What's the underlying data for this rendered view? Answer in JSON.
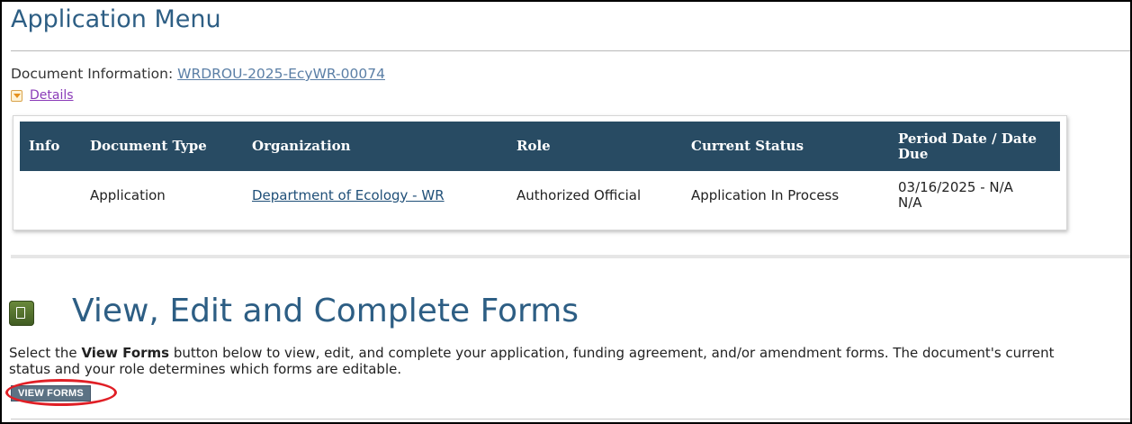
{
  "header": {
    "title": "Application Menu"
  },
  "document_info": {
    "label": "Document Information:",
    "id_link": "WRDROU-2025-EcyWR-00074",
    "details_link": "Details"
  },
  "doc_table": {
    "headers": [
      "Info",
      "Document Type",
      "Organization",
      "Role",
      "Current Status",
      "Period Date / Date Due"
    ],
    "rows": [
      {
        "info": "",
        "document_type": "Application",
        "organization": "Department of Ecology - WR",
        "role": "Authorized Official",
        "current_status": "Application In Process",
        "period_date": "03/16/2025 - N/A",
        "date_due": "N/A"
      }
    ]
  },
  "forms_section": {
    "title": "View, Edit and Complete Forms",
    "desc_pre": "Select the ",
    "desc_bold": "View Forms",
    "desc_post": " button below to view, edit, and complete your application, funding agreement, and/or amendment forms. The document's current status and your role determines which forms are editable.",
    "button_label": "VIEW FORMS",
    "icon": "document-icon"
  },
  "colors": {
    "title_blue": "#2d5e84",
    "table_header_bg": "#284b63",
    "button_bg": "#5c7284",
    "highlight_red": "#e01f26"
  }
}
